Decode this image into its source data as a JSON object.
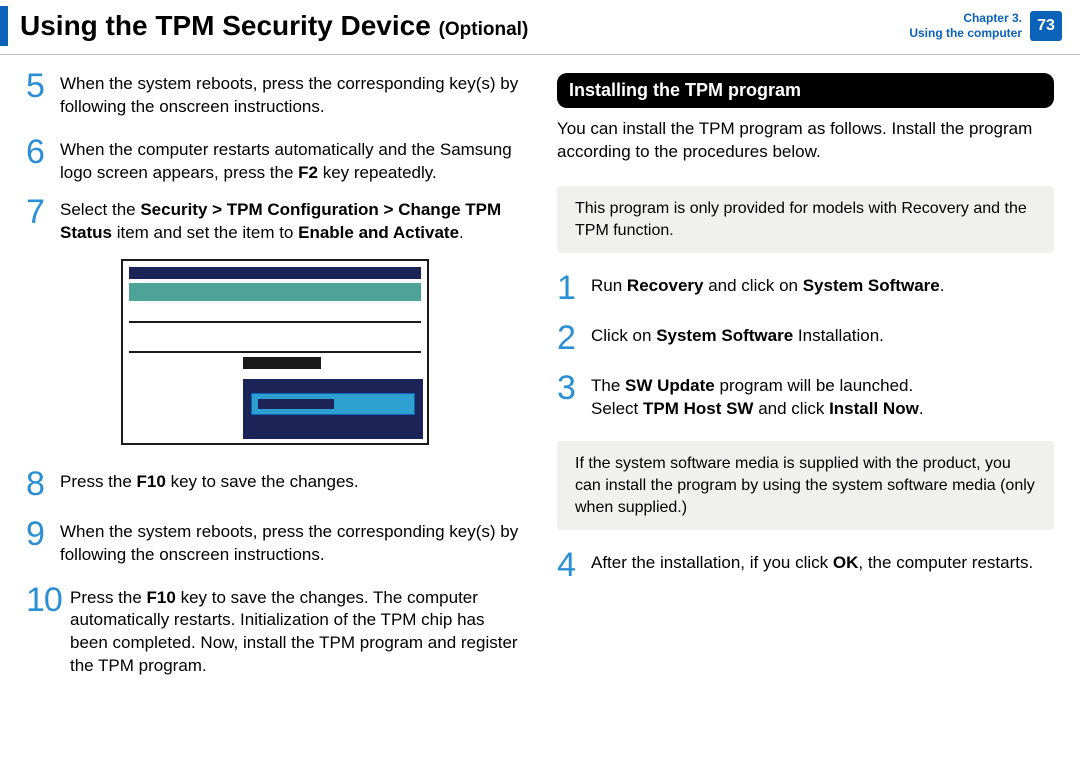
{
  "header": {
    "title_main": "Using the TPM Security Device",
    "title_optional": "(Optional)",
    "chapter_line1": "Chapter 3.",
    "chapter_line2": "Using the computer",
    "page": "73"
  },
  "left": {
    "step5": "When the system reboots, press the corresponding key(s) by following the onscreen instructions.",
    "step6_a": "When the computer restarts automatically and the Samsung logo screen appears, press the ",
    "step6_b": "F2",
    "step6_c": " key repeatedly.",
    "step7_a": "Select the ",
    "step7_b": "Security > TPM Configuration > Change TPM Status",
    "step7_c": " item and set the item to ",
    "step7_d": "Enable and Activate",
    "step7_e": ".",
    "step8_a": "Press the ",
    "step8_b": "F10",
    "step8_c": " key to save the changes.",
    "step9": "When the system reboots, press the corresponding key(s) by following the onscreen instructions.",
    "step10_a": "Press the ",
    "step10_b": "F10",
    "step10_c": " key to save the changes. The computer automatically restarts. Initialization of the TPM chip has been completed. Now, install the TPM program and register the TPM program."
  },
  "right": {
    "section": "Installing the TPM program",
    "intro": "You can install the TPM program as follows. Install the program according to the procedures below.",
    "note1": "This program is only provided for models with Recovery  and the TPM function.",
    "step1_a": "Run ",
    "step1_b": "Recovery",
    "step1_c": " and click on ",
    "step1_d": "System Software",
    "step1_e": ".",
    "step2_a": "Click on ",
    "step2_b": "System Software",
    "step2_c": " Installation.",
    "step3_a": "The ",
    "step3_b": "SW Update",
    "step3_c": " program will be launched.",
    "step3_d": "Select ",
    "step3_e": "TPM Host SW",
    "step3_f": " and click ",
    "step3_g": "Install Now",
    "step3_h": ".",
    "note2": "If the system software media is supplied with the product, you can install the program by using the system software media (only when supplied.)",
    "step4_a": "After the installation, if you click ",
    "step4_b": "OK",
    "step4_c": ", the computer restarts."
  }
}
